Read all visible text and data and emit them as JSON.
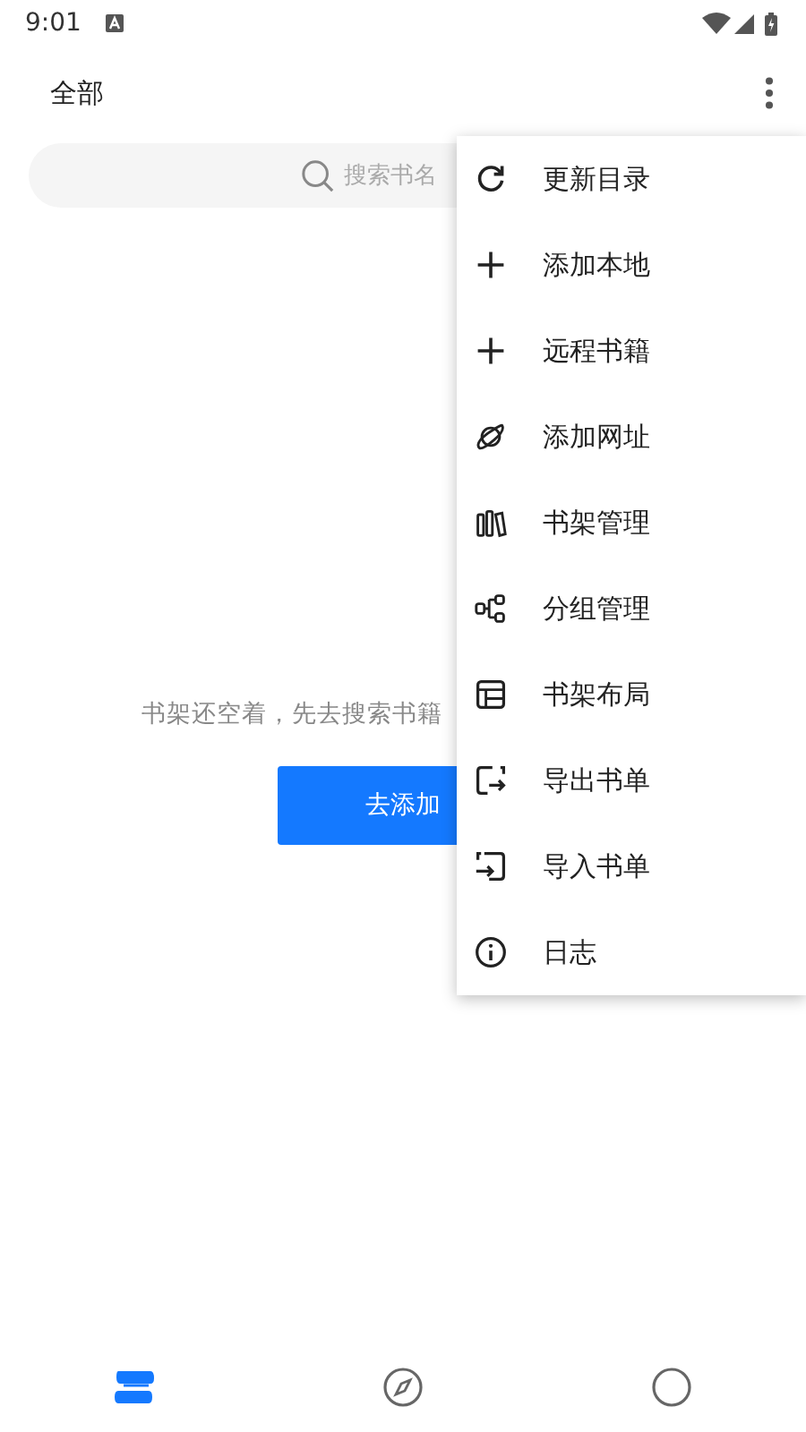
{
  "status_bar": {
    "time": "9:01"
  },
  "toolbar": {
    "title": "全部"
  },
  "search": {
    "placeholder": "搜索书名"
  },
  "empty_state": {
    "message": "书架还空着，先去搜索书籍",
    "button": "去添加"
  },
  "menu": {
    "items": [
      {
        "label": "更新目录"
      },
      {
        "label": "添加本地"
      },
      {
        "label": "远程书籍"
      },
      {
        "label": "添加网址"
      },
      {
        "label": "书架管理"
      },
      {
        "label": "分组管理"
      },
      {
        "label": "书架布局"
      },
      {
        "label": "导出书单"
      },
      {
        "label": "导入书单"
      },
      {
        "label": "日志"
      }
    ]
  },
  "bottom_nav": [
    {
      "selected": true
    },
    {
      "selected": false
    },
    {
      "selected": false
    }
  ]
}
